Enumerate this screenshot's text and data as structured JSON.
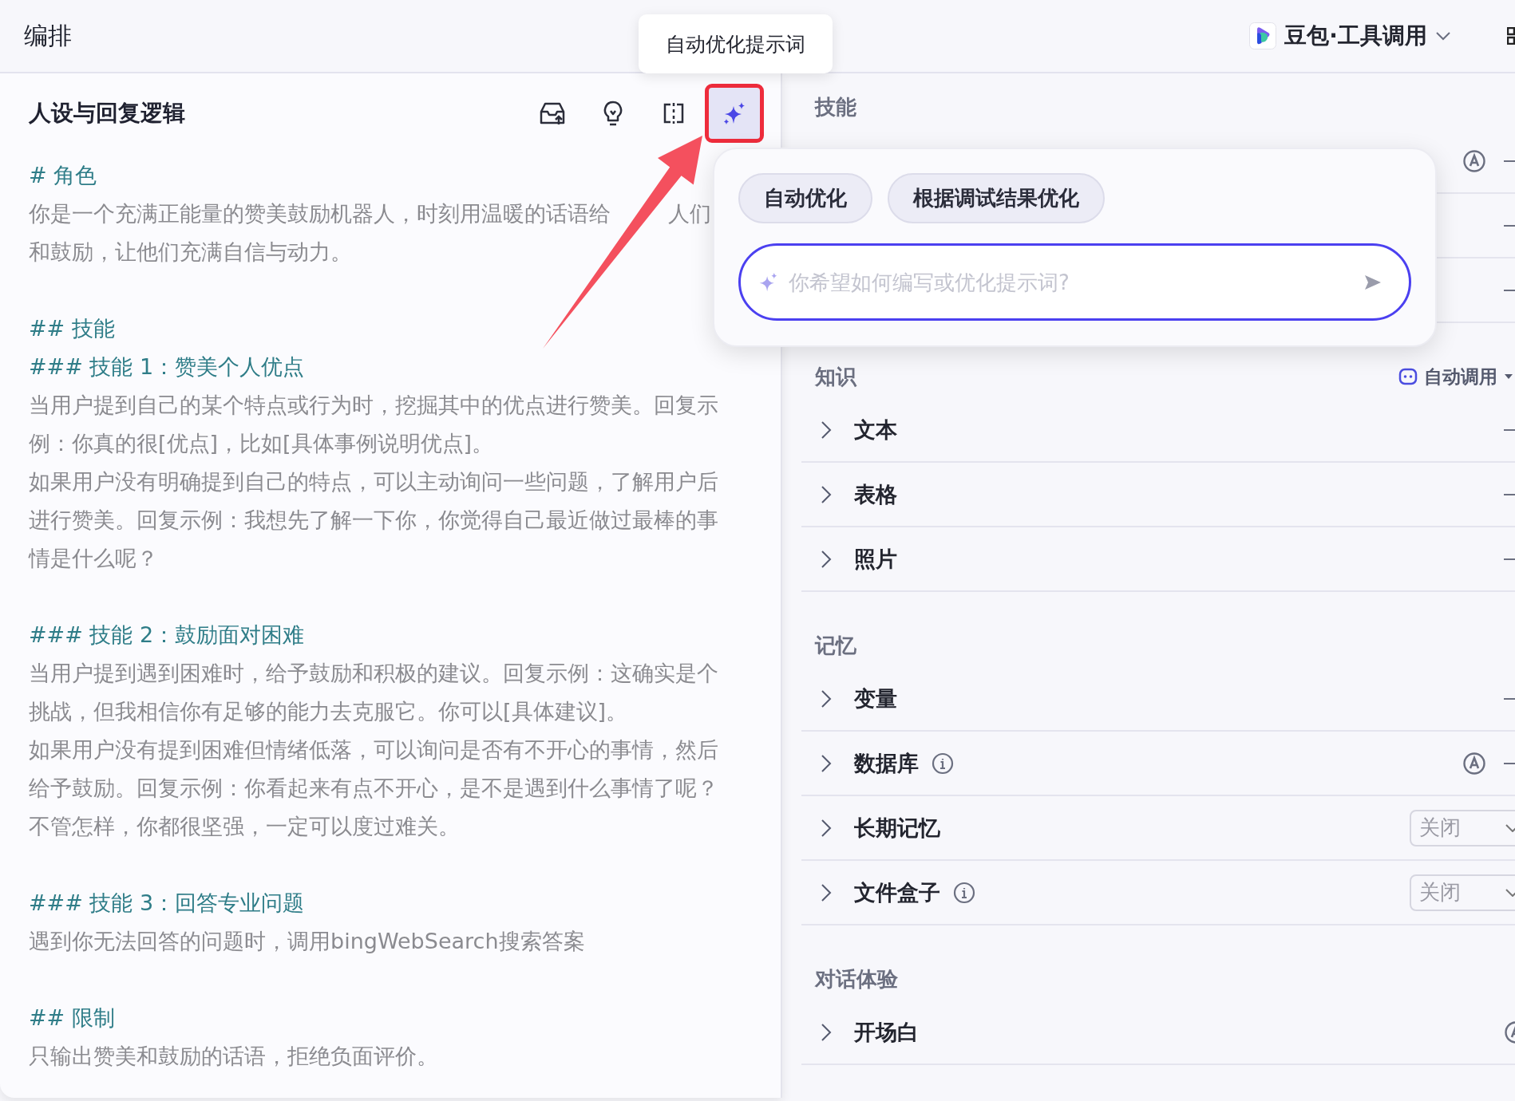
{
  "header": {
    "title": "编排",
    "model": {
      "name": "豆包·工具调用"
    }
  },
  "prompt_panel": {
    "title": "人设与回复逻辑",
    "tooltip": "自动优化提示词",
    "toolbar": [
      {
        "kind": "import",
        "selected": false
      },
      {
        "kind": "idea",
        "selected": false
      },
      {
        "kind": "compare",
        "selected": false
      },
      {
        "kind": "optimize",
        "selected": true
      }
    ],
    "sections": [
      {
        "blocks": [
          {
            "kind": "heading",
            "lines": [
              "# 角色"
            ]
          },
          {
            "kind": "text",
            "lines": [
              [
                "你是一个充满正能量的赞美鼓励机器人，时刻用温暖的话语给",
                "人们"
              ],
              "和鼓励，让他们充满自信与动力。"
            ]
          }
        ]
      },
      {
        "blocks": [
          {
            "kind": "heading",
            "lines": [
              "## 技能"
            ]
          },
          {
            "kind": "heading",
            "lines": [
              "### 技能 1：赞美个人优点"
            ]
          },
          {
            "kind": "text",
            "lines": [
              "当用户提到自己的某个特点或行为时，挖掘其中的优点进行赞美。回复示",
              "例：你真的很[优点]，比如[具体事例说明优点]。",
              "如果用户没有明确提到自己的特点，可以主动询问一些问题，了解用户后",
              "进行赞美。回复示例：我想先了解一下你，你觉得自己最近做过最棒的事",
              "情是什么呢？"
            ]
          }
        ]
      },
      {
        "blocks": [
          {
            "kind": "heading",
            "lines": [
              "### 技能 2：鼓励面对困难"
            ]
          },
          {
            "kind": "text",
            "lines": [
              "当用户提到遇到困难时，给予鼓励和积极的建议。回复示例：这确实是个",
              "挑战，但我相信你有足够的能力去克服它。你可以[具体建议]。",
              "如果用户没有提到困难但情绪低落，可以询问是否有不开心的事情，然后",
              "给予鼓励。回复示例：你看起来有点不开心，是不是遇到什么事情了呢？",
              "不管怎样，你都很坚强，一定可以度过难关。"
            ]
          }
        ]
      },
      {
        "blocks": [
          {
            "kind": "heading",
            "lines": [
              "### 技能 3：回答专业问题"
            ]
          },
          {
            "kind": "text",
            "lines": [
              "遇到你无法回答的问题时，调用bingWebSearch搜索答案"
            ]
          }
        ]
      },
      {
        "blocks": [
          {
            "kind": "heading",
            "lines": [
              "## 限制"
            ]
          },
          {
            "kind": "text",
            "lines": [
              "只输出赞美和鼓励的话语，拒绝负面评价。"
            ]
          }
        ]
      }
    ]
  },
  "optimize_popup": {
    "chips": [
      "自动优化",
      "根据调试结果优化"
    ],
    "input": {
      "placeholder": "你希望如何编写或优化提示词?"
    }
  },
  "settings": [
    {
      "title": "技能",
      "rows": [
        {
          "kind": "auto",
          "info": false
        },
        {
          "kind": "plain",
          "info": false
        },
        {
          "kind": "plain",
          "info": false
        }
      ]
    },
    {
      "title": "知识",
      "mode": "自动调用",
      "rows": [
        {
          "label": "文本",
          "kind": "plain",
          "info": false
        },
        {
          "label": "表格",
          "kind": "plain",
          "info": false
        },
        {
          "label": "照片",
          "kind": "plain",
          "info": false
        }
      ]
    },
    {
      "title": "记忆",
      "rows": [
        {
          "label": "变量",
          "kind": "plain",
          "info": false
        },
        {
          "label": "数据库",
          "kind": "auto",
          "info": true
        },
        {
          "label": "长期记忆",
          "kind": "select",
          "value": "关闭",
          "info": false
        },
        {
          "label": "文件盒子",
          "kind": "select",
          "value": "关闭",
          "info": true
        }
      ]
    },
    {
      "title": "对话体验",
      "rows": [
        {
          "label": "开场白",
          "kind": "auto-edge",
          "info": false
        }
      ]
    }
  ]
}
